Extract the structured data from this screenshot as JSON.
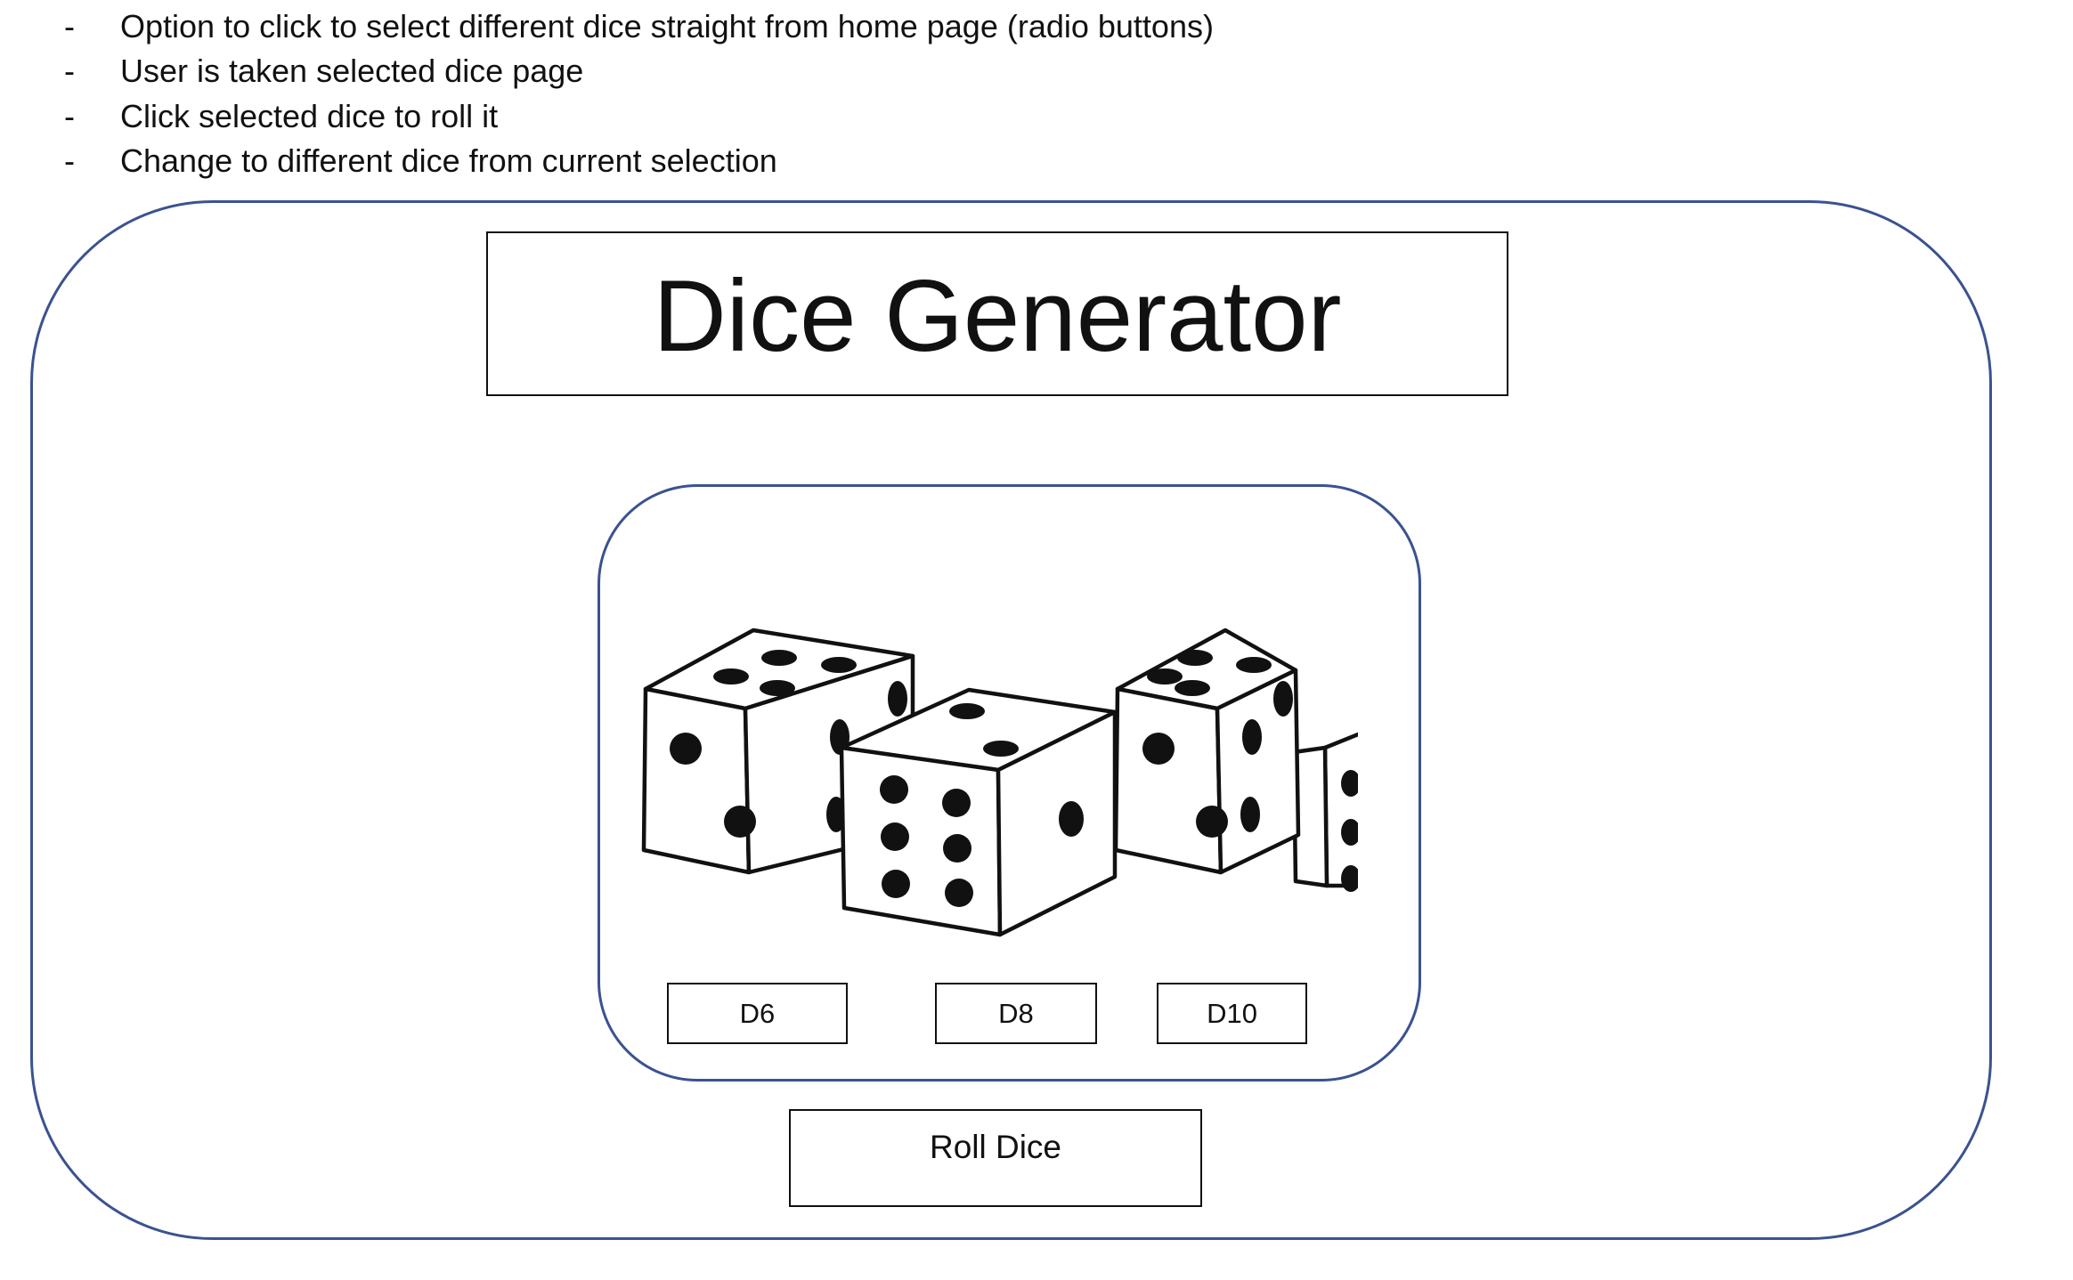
{
  "notes": [
    {
      "bullet": "-",
      "text": "Option to click to select different dice straight from home page (radio buttons)"
    },
    {
      "bullet": "-",
      "text": "User is taken selected dice page"
    },
    {
      "bullet": "-",
      "text": "Click selected dice to roll it"
    },
    {
      "bullet": "-",
      "text": "Change to different dice from current selection"
    }
  ],
  "app": {
    "title": "Dice Generator"
  },
  "dice_options": [
    {
      "label": "D6"
    },
    {
      "label": "D8"
    },
    {
      "label": "D10"
    }
  ],
  "roll_button": {
    "label": "Roll Dice"
  },
  "dice_illustration": {
    "icon": "dice-group-icon"
  },
  "colors": {
    "frame_border": "#3a5290",
    "line": "#111111"
  }
}
